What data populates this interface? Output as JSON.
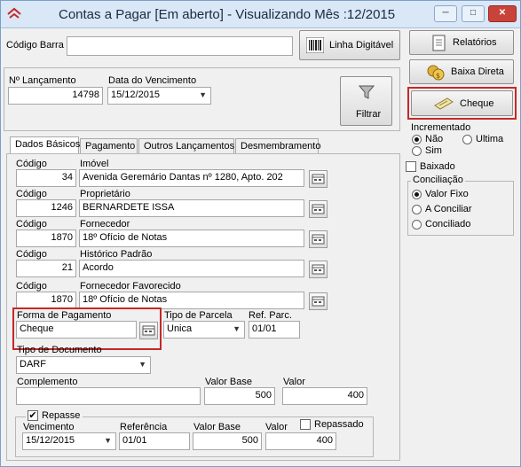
{
  "window": {
    "title": "Contas a Pagar [Em aberto] - Visualizando Mês :12/2015",
    "min_label": "─",
    "max_label": "□",
    "close_label": "✕"
  },
  "top": {
    "codigo_barra_label": "Código Barra",
    "codigo_barra_value": "",
    "linha_digitavel_label": "Linha Digitável"
  },
  "lancamento": {
    "num_label": "Nº Lançamento",
    "num_value": "14798",
    "vencimento_label": "Data do Vencimento",
    "vencimento_value": "15/12/2015",
    "filtrar_label": "Filtrar"
  },
  "sidebar": {
    "relatorios_label": "Relatórios",
    "baixa_direta_label": "Baixa Direta",
    "cheque_label": "Cheque",
    "incrementado_label": "Incrementado",
    "incrementado_options": [
      "Não",
      "Ultima",
      "Sim"
    ],
    "baixado_label": "Baixado",
    "conciliacao_label": "Conciliação",
    "conciliacao_options": [
      "Valor Fixo",
      "A Conciliar",
      "Conciliado"
    ]
  },
  "tabs": [
    "Dados Básicos",
    "Pagamento",
    "Outros Lançamentos",
    "Desmembramento"
  ],
  "fields": {
    "codigo_label": "Código",
    "imovel_label": "Imóvel",
    "imovel_code": "34",
    "imovel_value": "Avenida Geremário Dantas nº 1280, Apto. 202",
    "proprietario_label": "Proprietário",
    "proprietario_code": "1246",
    "proprietario_value": "BERNARDETE ISSA",
    "fornecedor_label": "Fornecedor",
    "fornecedor_code": "1870",
    "fornecedor_value": "18º Ofício de Notas",
    "historico_label": "Histórico Padrão",
    "historico_code": "21",
    "historico_value": "Acordo",
    "favorecido_label": "Fornecedor Favorecido",
    "favorecido_code": "1870",
    "favorecido_value": "18º Ofício de Notas",
    "forma_pagamento_label": "Forma de Pagamento",
    "forma_pagamento_value": "Cheque",
    "tipo_parcela_label": "Tipo de Parcela",
    "tipo_parcela_value": "Unica",
    "ref_parc_label": "Ref. Parc.",
    "ref_parc_value": "01/01",
    "tipo_documento_label": "Tipo de Documento",
    "tipo_documento_value": "DARF",
    "complemento_label": "Complemento",
    "complemento_value": "",
    "valor_base_label": "Valor Base",
    "valor_base_value": "500",
    "valor_label": "Valor",
    "valor_value": "400"
  },
  "repasse": {
    "repasse_label": "Repasse",
    "vencimento_label": "Vencimento",
    "vencimento_value": "15/12/2015",
    "referencia_label": "Referência",
    "referencia_value": "01/01",
    "valor_base_label": "Valor Base",
    "valor_base_value": "500",
    "valor_label": "Valor",
    "valor_value": "400",
    "repassado_label": "Repassado"
  },
  "colors": {
    "highlight": "#c62828",
    "titlebar": "#d9e7f6"
  },
  "icons": [
    "app-logo-icon",
    "barcode-icon",
    "funnel-icon",
    "report-icon",
    "coins-icon",
    "cheque-icon",
    "lookup-icon"
  ]
}
